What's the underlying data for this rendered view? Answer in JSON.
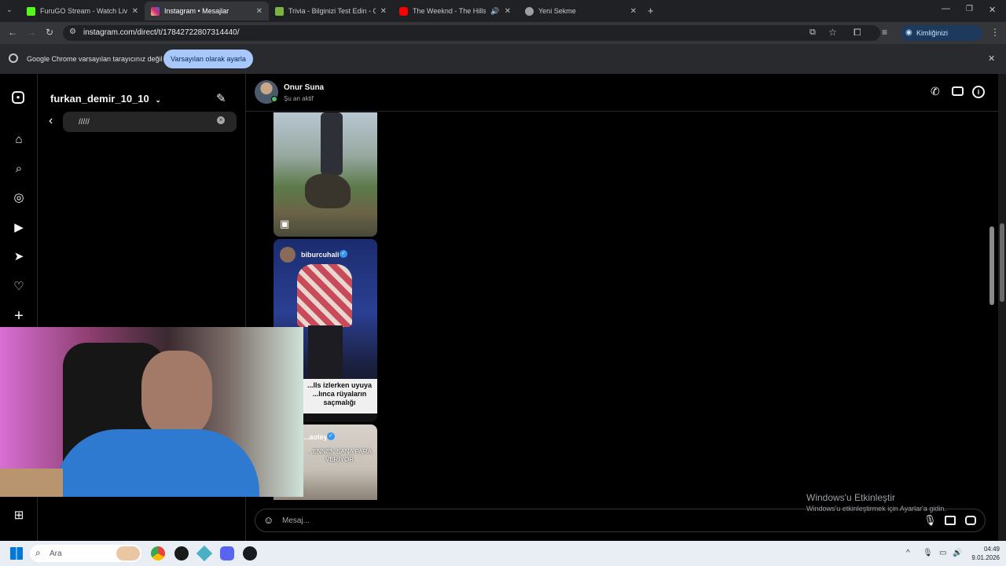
{
  "browser": {
    "tabs": [
      {
        "title": "FuruGO Stream - Watch Live or",
        "favicon_color": "#53fc18"
      },
      {
        "title": "Instagram • Mesajlar",
        "favicon_color": "#dd2a7b"
      },
      {
        "title": "Trivia - Bilginizi Test Edin - Quiz",
        "favicon_color": "#7cb342"
      },
      {
        "title": "The Weeknd - The Hills - Yo",
        "favicon_color": "#ff0000"
      },
      {
        "title": "Yeni Sekme",
        "favicon_color": "#9aa0a6"
      }
    ],
    "url": "instagram.com/direct/t/17842722807314440/",
    "verify_label": "Kimliğinizi doğrulayın",
    "infobar_message": "Google Chrome varsayılan tarayıcınız değil",
    "infobar_button": "Varsayılan olarak ayarla"
  },
  "instagram": {
    "username": "furkan_demir_10_10",
    "search_value": "/////",
    "chat": {
      "contact_name": "Onur Suna",
      "contact_status": "Şu an aktif",
      "posts": [
        {
          "kind": "reel"
        },
        {
          "author": "biburcuhali",
          "caption": "...lls izlerken uyuya\n...lınca rüyaların\nsaçmalığı"
        },
        {
          "author": "...aoleyv",
          "caption": "...ENNEN SANA PARA\nVERİYOR"
        }
      ],
      "composer_placeholder": "Mesaj..."
    }
  },
  "watermark": {
    "title": "Windows'u Etkinleştir",
    "subtitle": "Windows'u etkinleştirmek için Ayarlar'a gidin."
  },
  "taskbar": {
    "search_placeholder": "Ara",
    "time": "04:49",
    "date": "9.01.2026"
  }
}
